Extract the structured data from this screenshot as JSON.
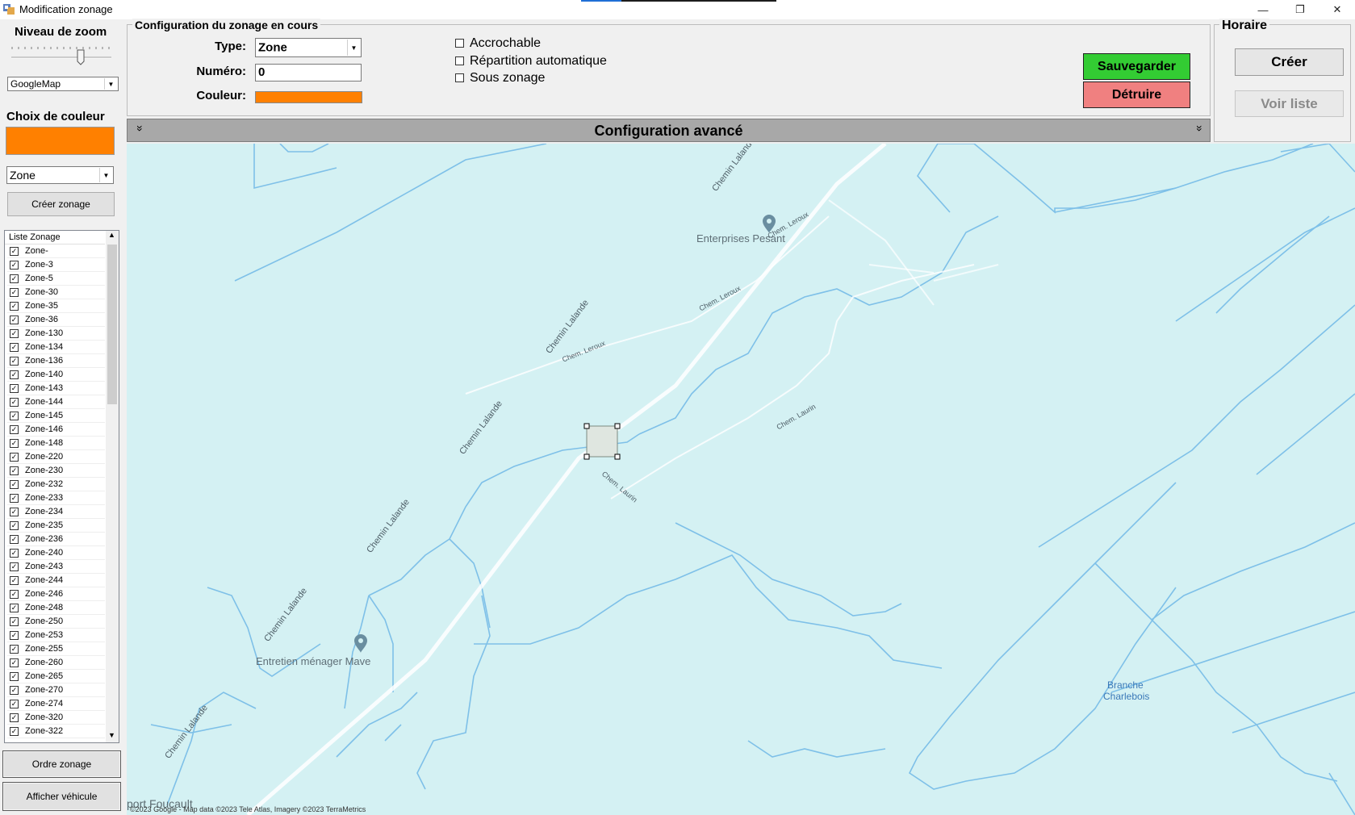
{
  "window": {
    "title": "Modification zonage",
    "controls": {
      "minimize": "—",
      "restore": "❐",
      "close": "✕"
    }
  },
  "left_panel": {
    "zoom_label": "Niveau de zoom",
    "map_type": "GoogleMap",
    "color_label": "Choix de couleur",
    "color_swatch": "#ff8000",
    "zone_type": "Zone",
    "create_zonage_button": "Créer zonage",
    "list_header": "Liste Zonage",
    "zones": [
      "Zone-",
      "Zone-3",
      "Zone-5",
      "Zone-30",
      "Zone-35",
      "Zone-36",
      "Zone-130",
      "Zone-134",
      "Zone-136",
      "Zone-140",
      "Zone-143",
      "Zone-144",
      "Zone-145",
      "Zone-146",
      "Zone-148",
      "Zone-220",
      "Zone-230",
      "Zone-232",
      "Zone-233",
      "Zone-234",
      "Zone-235",
      "Zone-236",
      "Zone-240",
      "Zone-243",
      "Zone-244",
      "Zone-246",
      "Zone-248",
      "Zone-250",
      "Zone-253",
      "Zone-255",
      "Zone-260",
      "Zone-265",
      "Zone-270",
      "Zone-274",
      "Zone-320",
      "Zone-322"
    ],
    "order_button": "Ordre zonage",
    "vehicle_button": "Afficher véhicule"
  },
  "config": {
    "group_title": "Configuration du zonage en cours",
    "type_label": "Type:",
    "type_value": "Zone",
    "number_label": "Numéro:",
    "number_value": "0",
    "color_label": "Couleur:",
    "color_value": "#ff8000",
    "checkboxes": [
      "Accrochable",
      "Répartition automatique",
      "Sous zonage"
    ],
    "save_button": "Sauvegarder",
    "destroy_button": "Détruire",
    "save_color": "#33cc33",
    "destroy_color": "#f08080"
  },
  "horaire": {
    "title": "Horaire",
    "create_button": "Créer",
    "list_button": "Voir liste"
  },
  "advanced": {
    "title": "Configuration avancé",
    "expand_icon": "»"
  },
  "map": {
    "labels": {
      "chemin_lalande": "Chemin Lalande",
      "chem_leroux": "Chem. Leroux",
      "chem_laurin": "Chem. Laurin"
    },
    "pois": {
      "pesant": "Enterprises Pesant",
      "mave": "Entretien ménager Mave",
      "branche_1": "Branche",
      "branche_2": "Charlebois"
    },
    "place_partial": "port Foucault",
    "attribution": "©2023 Google - Map data ©2023 Tele Atlas, Imagery ©2023 TerraMetrics"
  }
}
